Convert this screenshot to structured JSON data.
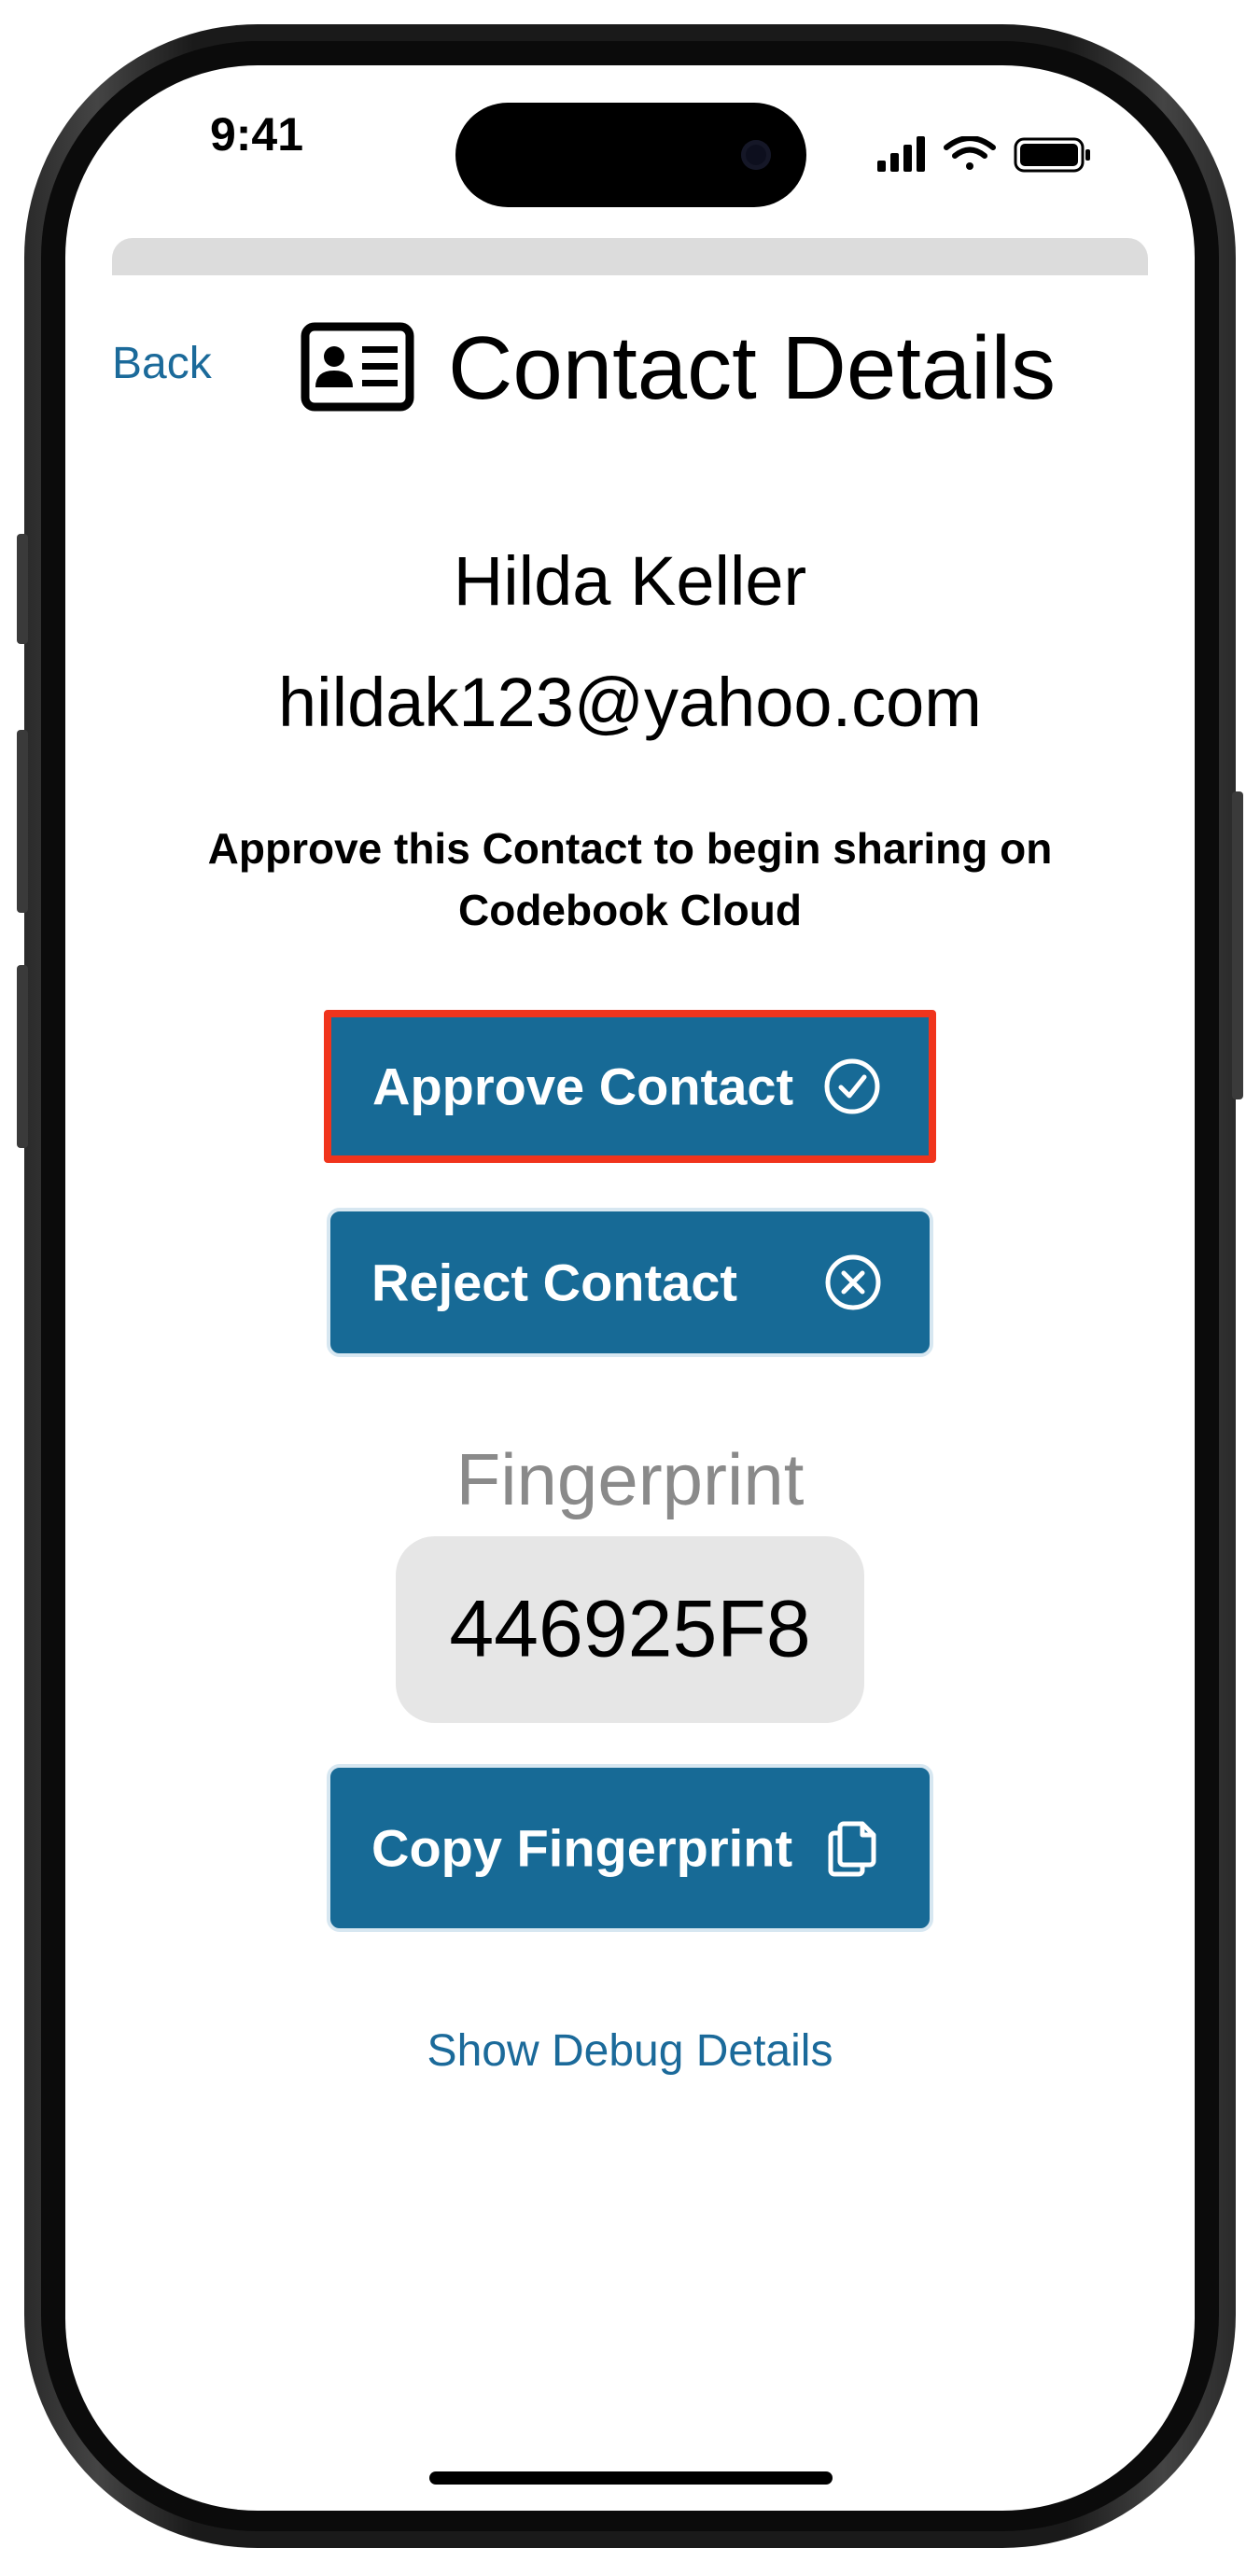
{
  "status_bar": {
    "time": "9:41",
    "icons": [
      "cellular-signal-icon",
      "wifi-icon",
      "battery-icon"
    ]
  },
  "header": {
    "back_label": "Back",
    "title_icon": "contact-card-icon",
    "title": "Contact Details"
  },
  "contact": {
    "name": "Hilda Keller",
    "email": "hildak123@yahoo.com"
  },
  "instruction": "Approve this Contact to begin sharing on Codebook Cloud",
  "actions": {
    "approve_label": "Approve Contact",
    "approve_icon": "checkmark-circle-icon",
    "reject_label": "Reject Contact",
    "reject_icon": "x-circle-icon",
    "copy_label": "Copy Fingerprint",
    "copy_icon": "copy-documents-icon"
  },
  "fingerprint": {
    "label": "Fingerprint",
    "value": "446925F8"
  },
  "debug_link_label": "Show Debug Details",
  "colors": {
    "accent": "#176a96",
    "link": "#1b6a9a",
    "highlight_border": "#f0341c",
    "fingerprint_box": "#e6e6e6"
  }
}
